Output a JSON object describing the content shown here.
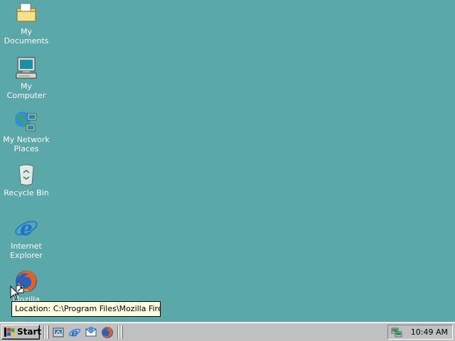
{
  "desktop": {
    "icons": [
      {
        "label": "My Documents"
      },
      {
        "label": "My Computer"
      },
      {
        "label": "My Network Places"
      },
      {
        "label": "Recycle Bin"
      },
      {
        "label": "Internet Explorer"
      },
      {
        "label": "Mozilla Firefox"
      }
    ],
    "tooltip": "Location: C:\\Program Files\\Mozilla Firefox"
  },
  "taskbar": {
    "start_label": "Start",
    "quick_launch": [
      "show-desktop-icon",
      "internet-explorer-icon",
      "outlook-express-icon",
      "firefox-icon"
    ],
    "clock": "10:49 AM"
  },
  "colors": {
    "desktop_bg": "#5aa8a8",
    "taskbar_bg": "#c0c0c0",
    "tooltip_bg": "#ffffe1"
  }
}
